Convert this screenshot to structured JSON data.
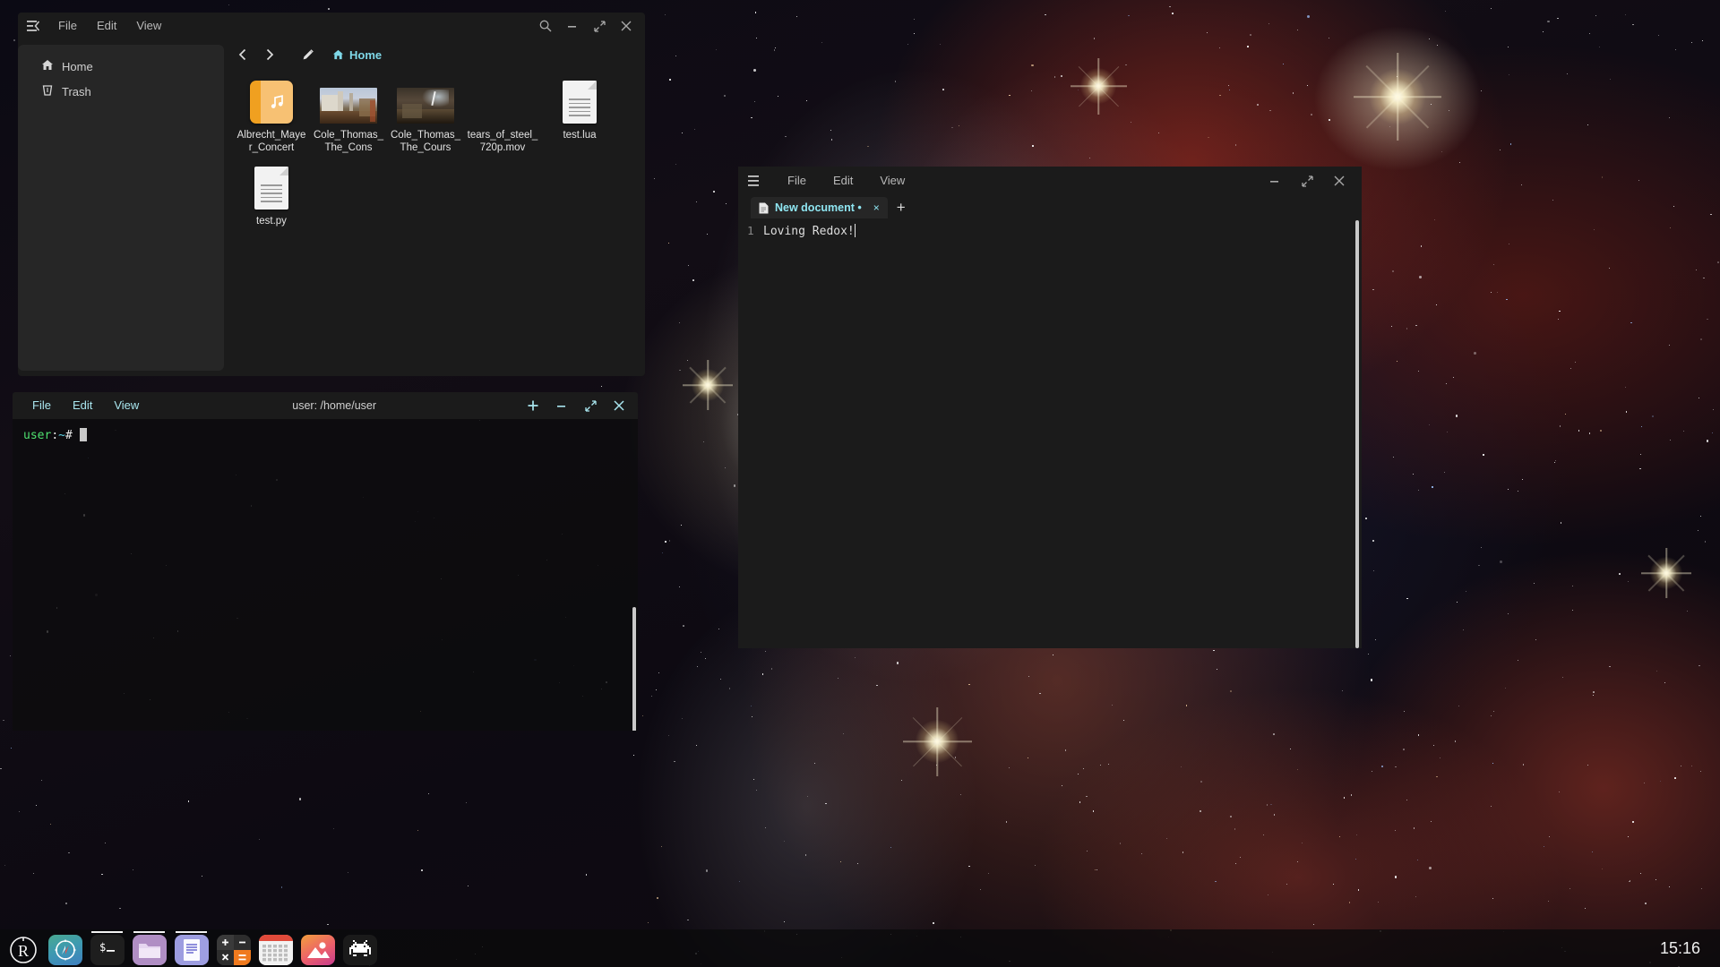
{
  "desktop": {
    "wallpaper_name": "jwst-tarantula-nebula"
  },
  "file_manager": {
    "window_name": "File Manager",
    "menus": [
      "File",
      "Edit",
      "View"
    ],
    "hamburger_icon": "hamburger-icon",
    "titlebar_buttons": [
      {
        "name": "search-icon",
        "label": "⌕"
      },
      {
        "name": "minimize-icon",
        "label": "–"
      },
      {
        "name": "maximize-icon",
        "label": "⤡"
      },
      {
        "name": "close-icon",
        "label": "×"
      }
    ],
    "sidebar": [
      {
        "label": "Home",
        "icon": "home-icon"
      },
      {
        "label": "Trash",
        "icon": "trash-icon"
      }
    ],
    "toolbar": {
      "back_icon": "chevron-left-icon",
      "forward_icon": "chevron-right-icon",
      "edit_path_icon": "pencil-icon"
    },
    "breadcrumb": {
      "icon": "home-icon",
      "label": "Home"
    },
    "files": [
      {
        "label": "Albrecht_Mayer_Concert",
        "type": "music",
        "icon": "music-file-icon"
      },
      {
        "label": "Cole_Thomas_The_Cons",
        "type": "image",
        "icon": "image-thumbnail"
      },
      {
        "label": "Cole_Thomas_The_Cours",
        "type": "image",
        "icon": "image-thumbnail"
      },
      {
        "label": "tears_of_steel_720p.mov",
        "type": "video",
        "icon": "video-file-icon"
      },
      {
        "label": "test.lua",
        "type": "document",
        "icon": "document-file-icon"
      },
      {
        "label": "test.py",
        "type": "document",
        "icon": "document-file-icon"
      }
    ]
  },
  "terminal": {
    "window_name": "Terminal",
    "menus": [
      "File",
      "Edit",
      "View"
    ],
    "title": "user: /home/user",
    "titlebar_buttons": [
      {
        "name": "new-tab-icon",
        "label": "+"
      },
      {
        "name": "minimize-icon",
        "label": "–"
      },
      {
        "name": "maximize-icon",
        "label": "⤡"
      },
      {
        "name": "close-icon",
        "label": "×"
      }
    ],
    "prompt": {
      "user": "user",
      "colon": ":",
      "path": "~",
      "sigil": "#",
      "input": ""
    }
  },
  "editor": {
    "window_name": "Text Editor",
    "hamburger_icon": "hamburger-icon",
    "menus": [
      "File",
      "Edit",
      "View"
    ],
    "titlebar_buttons": [
      {
        "name": "minimize-icon",
        "label": "–"
      },
      {
        "name": "maximize-icon",
        "label": "⤡"
      },
      {
        "name": "close-icon",
        "label": "×"
      }
    ],
    "tabs": [
      {
        "label": "New document •",
        "modified": true,
        "close_label": "×",
        "icon": "document-icon"
      }
    ],
    "new_tab_label": "+",
    "document": {
      "line_number": "1",
      "text": "Loving Redox!"
    }
  },
  "taskbar": {
    "launchers": [
      {
        "name": "redox-menu-button",
        "icon": "redox-logo-icon",
        "running": false
      },
      {
        "name": "browser-launcher",
        "icon": "compass-icon",
        "running": false
      },
      {
        "name": "terminal-launcher",
        "icon": "terminal-prompt-icon",
        "running": true
      },
      {
        "name": "file-manager-launcher",
        "icon": "folder-icon",
        "running": true
      },
      {
        "name": "text-editor-launcher",
        "icon": "document-icon",
        "running": true
      },
      {
        "name": "calculator-launcher",
        "icon": "calculator-icon",
        "running": false
      },
      {
        "name": "calendar-launcher",
        "icon": "calendar-icon",
        "running": false
      },
      {
        "name": "image-viewer-launcher",
        "icon": "photo-icon",
        "running": false
      },
      {
        "name": "game-launcher",
        "icon": "space-invader-icon",
        "running": false
      }
    ],
    "clock": "15:16"
  },
  "colors": {
    "accent_cyan": "#8fe6f2",
    "terminal_green": "#4fe06f",
    "window_bg": "#1b1b1b",
    "panel_bg": "#262626"
  }
}
